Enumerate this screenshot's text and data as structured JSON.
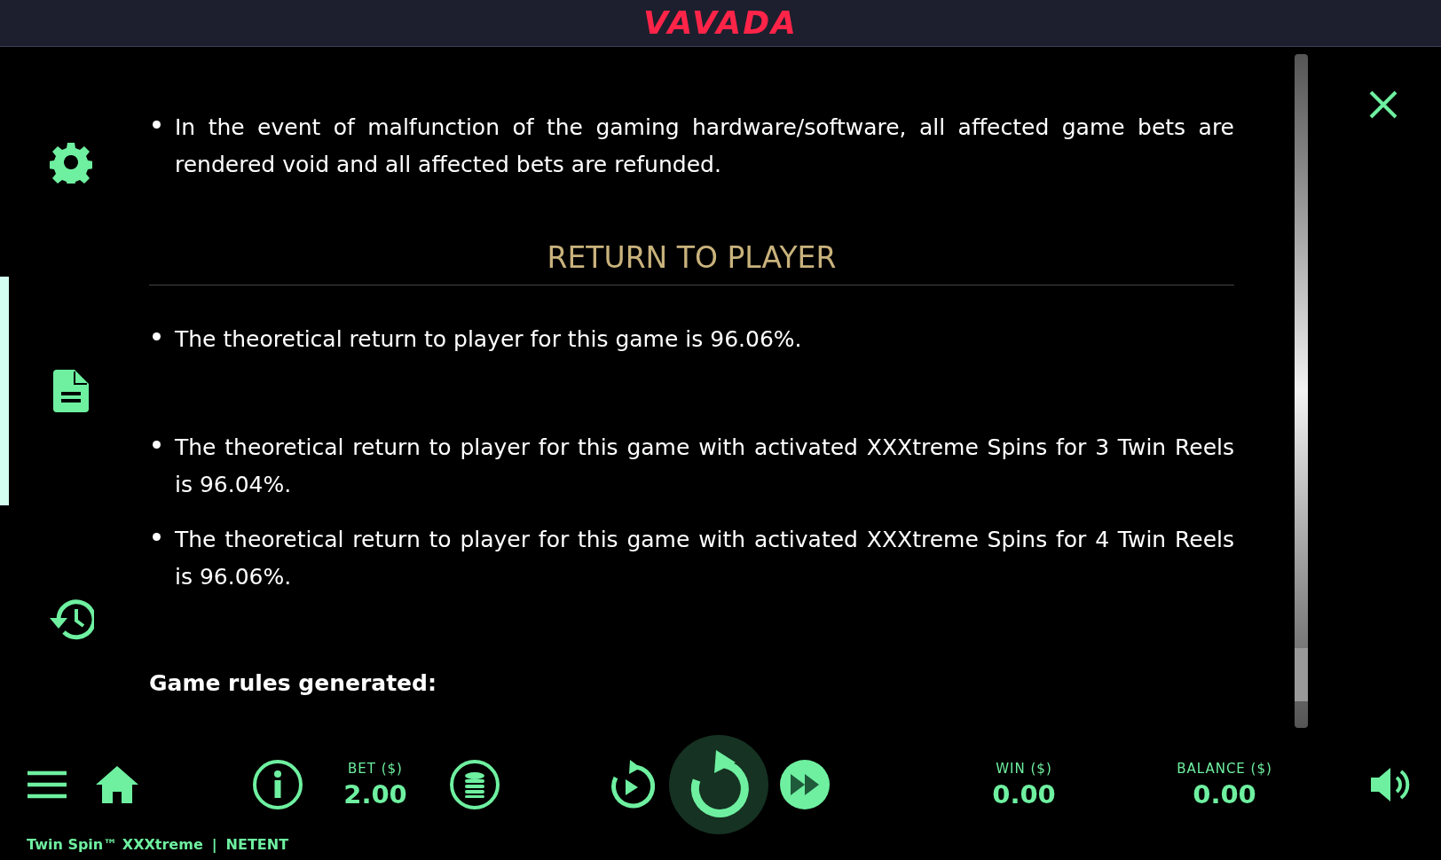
{
  "header": {
    "logo": "VAVADA"
  },
  "sidebar": {
    "items": [
      {
        "kind": "settings",
        "selected": false
      },
      {
        "kind": "rules",
        "selected": true
      },
      {
        "kind": "history",
        "selected": false
      }
    ]
  },
  "content": {
    "blocks": [
      {
        "kind": "bullet",
        "text": "In the event of malfunction of the gaming hardware/software, all affected game bets are rendered void and all affected bets are refunded."
      },
      {
        "kind": "heading",
        "text": "RETURN TO PLAYER"
      },
      {
        "kind": "bullet",
        "text": "The theoretical return to player for this game is 96.06%."
      },
      {
        "kind": "spacer"
      },
      {
        "kind": "bullet",
        "text": "The theoretical return to player for this game with activated XXXtreme Spins for 3 Twin Reels is 96.04%."
      },
      {
        "kind": "bullet",
        "text": "The theoretical return to player for this game with activated XXXtreme Spins for 4 Twin Reels is 96.06%."
      },
      {
        "kind": "subheading",
        "text": "Game rules generated:"
      }
    ]
  },
  "bottom_bar": {
    "bet": {
      "label": "BET ($)",
      "value": "2.00"
    },
    "win": {
      "label": "WIN ($)",
      "value": "0.00"
    },
    "balance": {
      "label": "BALANCE ($)",
      "value": "0.00"
    }
  },
  "footer": {
    "game": "Twin Spin™ XXXtreme",
    "separator": "|",
    "provider": "NETENT"
  }
}
